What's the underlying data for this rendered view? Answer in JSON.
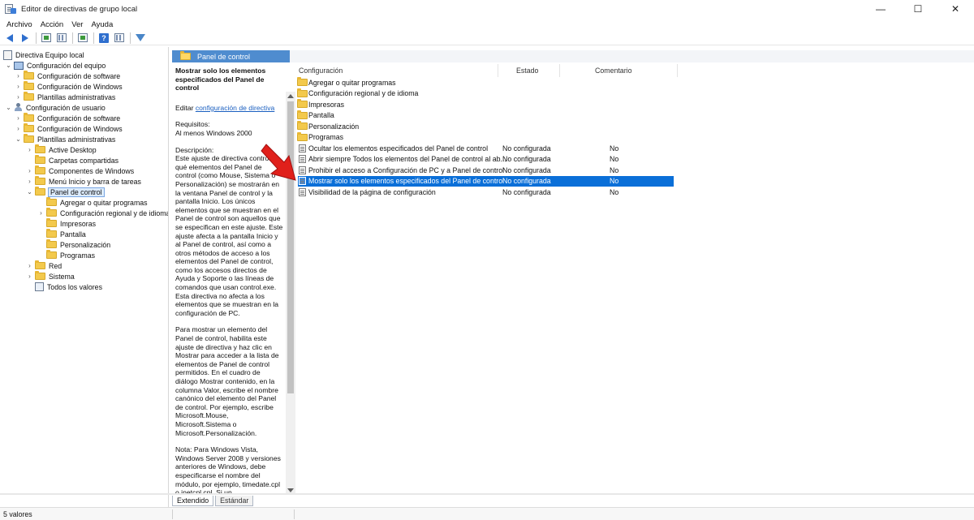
{
  "window": {
    "title": "Editor de directivas de grupo local",
    "minimize": "—",
    "maximize": "☐",
    "close": "✕"
  },
  "menu": [
    "Archivo",
    "Acción",
    "Ver",
    "Ayuda"
  ],
  "tree": {
    "root": "Directiva Equipo local",
    "computer_config": "Configuración del equipo",
    "software_config": "Configuración de software",
    "windows_config": "Configuración de Windows",
    "admin_templates": "Plantillas administrativas",
    "user_config": "Configuración de usuario",
    "user_software_config": "Configuración de software",
    "user_windows_config": "Configuración de Windows",
    "user_admin_templates": "Plantillas administrativas",
    "active_desktop": "Active Desktop",
    "shared_folders": "Carpetas compartidas",
    "windows_components": "Componentes de Windows",
    "start_menu": "Menú Inicio y barra de tareas",
    "control_panel": "Panel de control",
    "add_remove": "Agregar o quitar programas",
    "regional": "Configuración regional y de idioma",
    "printers": "Impresoras",
    "display": "Pantalla",
    "personalization": "Personalización",
    "programs": "Programas",
    "network": "Red",
    "system": "Sistema",
    "all_values": "Todos los valores"
  },
  "header": {
    "title": "Panel de control"
  },
  "description": {
    "title": "Mostrar solo los elementos especificados del Panel de control",
    "edit_prefix": "Editar ",
    "edit_link": "configuración de directiva",
    "requirements_label": "Requisitos:",
    "requirements_value": "Al menos Windows 2000",
    "description_label": "Descripción:",
    "paragraph1": "Este ajuste de directiva controla qué elementos del Panel de control (como Mouse, Sistema o Personalización) se mostrarán en la ventana Panel de control y la pantalla Inicio. Los únicos elementos que se muestran en el Panel de control son aquellos que se especifican en este ajuste. Este ajuste afecta a la pantalla Inicio y al Panel de control, así como a otros métodos de acceso a los elementos del Panel de control, como los accesos directos de Ayuda y Soporte o las líneas de comandos que usan control.exe. Esta directiva no afecta a los elementos que se muestran en la configuración de PC.",
    "paragraph2": "Para mostrar un elemento del Panel de control, habilita este ajuste de directiva y haz clic en Mostrar para acceder a la lista de elementos de Panel de control permitidos. En el cuadro de diálogo Mostrar contenido, en la columna Valor, escribe el nombre canónico del elemento del Panel de control. Por ejemplo, escribe Microsoft.Mouse, Microsoft.Sistema o Microsoft.Personalización.",
    "paragraph3": "Nota: Para Windows Vista, Windows Server 2008 y versiones anteriores de Windows, debe especificarse el nombre del módulo, por ejemplo, timedate.cpl o inetcpl.cpl. Si un"
  },
  "list": {
    "columns": {
      "name": "Configuración",
      "state": "Estado",
      "comment": "Comentario"
    },
    "folders": [
      "Agregar o quitar programas",
      "Configuración regional y de idioma",
      "Impresoras",
      "Pantalla",
      "Personalización",
      "Programas"
    ],
    "settings": [
      {
        "name": "Ocultar los elementos especificados del Panel de control",
        "state": "No configurada",
        "comment": "No"
      },
      {
        "name": "Abrir siempre Todos los elementos del Panel de control al ab...",
        "state": "No configurada",
        "comment": "No"
      },
      {
        "name": "Prohibir el acceso a Configuración de PC y a Panel de control",
        "state": "No configurada",
        "comment": "No"
      },
      {
        "name": "Mostrar solo los elementos especificados del Panel de control",
        "state": "No configurada",
        "comment": "No"
      },
      {
        "name": "Visibilidad de la página de configuración",
        "state": "No configurada",
        "comment": "No"
      }
    ]
  },
  "tabs": {
    "extended": "Extendido",
    "standard": "Estándar"
  },
  "status": {
    "count": "5 valores"
  },
  "colors": {
    "accent": "#0a6fd8",
    "header": "#4f8ccf",
    "pointer": "#e0201b"
  }
}
